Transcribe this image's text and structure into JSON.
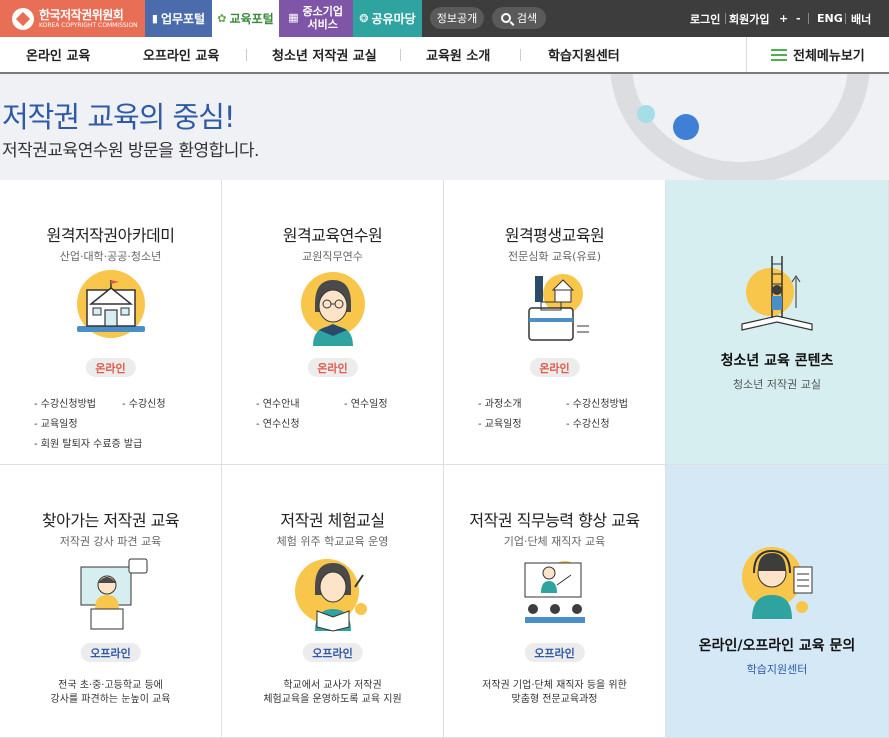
{
  "topbar": {
    "brand": {
      "name": "한국저작권위원회",
      "sub": "KOREA COPYRIGHT COMMISSION"
    },
    "portals": [
      {
        "label": "업무포털",
        "color": "#4a6cac"
      },
      {
        "label": "교육포털",
        "color": "#ffffff"
      },
      {
        "label": "중소기업 서비스",
        "color": "#7f55a7"
      },
      {
        "label": "공유마당",
        "color": "#2ea3a0"
      }
    ],
    "info_label": "정보공개",
    "search_label": "검색",
    "util": {
      "login": "로그인",
      "join": "회원가입",
      "zoom_in": "+",
      "zoom_out": "-",
      "eng": "ENG",
      "banner": "배너"
    }
  },
  "nav": {
    "items": [
      "온라인 교육",
      "오프라인 교육",
      "청소년 저작권 교실",
      "교육원 소개",
      "학습지원센터"
    ],
    "all_menu": "전체메뉴보기"
  },
  "hero": {
    "title": "저작권 교육의 중심!",
    "subtitle": "저작권교육연수원 방문을 환영합니다."
  },
  "cards_row1": [
    {
      "title": "원격저작권아카데미",
      "sub": "산업·대학·공공·청소년",
      "badge": "온라인",
      "links": [
        "- 수강신청방법",
        "- 수강신청",
        "- 교육일정",
        "- 회원 탈퇴자 수료증 발급"
      ]
    },
    {
      "title": "원격교육연수원",
      "sub": "교원직무연수",
      "badge": "온라인",
      "links": [
        "- 연수안내",
        "- 연수일정",
        "- 연수신청"
      ]
    },
    {
      "title": "원격평생교육원",
      "sub": "전문심화 교육(유료)",
      "badge": "온라인",
      "links": [
        "- 과정소개",
        "- 수강신청방법",
        "- 교육일정",
        "- 수강신청"
      ]
    }
  ],
  "cards_row2": [
    {
      "title": "찾아가는 저작권 교육",
      "sub": "저작권 강사 파견 교육",
      "badge": "오프라인",
      "desc": [
        "전국 초·중·고등학교 등에",
        "강사를 파견하는 눈높이 교육"
      ]
    },
    {
      "title": "저작권 체험교실",
      "sub": "체험 위주 학교교육 운영",
      "badge": "오프라인",
      "desc": [
        "학교에서 교사가 저작권",
        "체험교육을 운영하도록 교육 지원"
      ]
    },
    {
      "title": "저작권 직무능력 향상 교육",
      "sub": "기업·단체 재직자 교육",
      "badge": "오프라인",
      "desc": [
        "저작권 기업·단체 재직자 등을 위한",
        "맞춤형 전문교육과정"
      ]
    }
  ],
  "side": {
    "youth": {
      "title": "청소년 교육 콘텐츠",
      "sub": "청소년 저작권 교실",
      "bg": "#d6eef0"
    },
    "inquiry": {
      "title": "온라인/오프라인 교육 문의",
      "sub": "학습지원센터",
      "bg": "#d4e8f6"
    }
  },
  "colors": {
    "accent_blue": "#2f5aa8",
    "badge_online": "#e25a4a",
    "illus_yellow": "#f7c64a"
  }
}
